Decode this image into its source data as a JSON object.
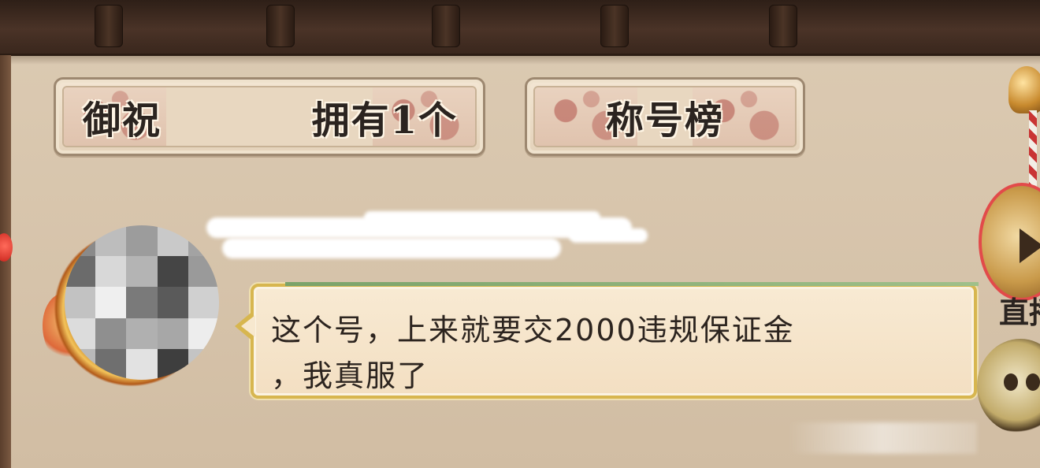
{
  "tabs": {
    "blessing": {
      "title": "御祝",
      "count": "拥有1个"
    },
    "title_rank": {
      "label": "称号榜"
    }
  },
  "chat": {
    "message": "这个号，上来就要交2000违规保证金\n，我真服了"
  },
  "side": {
    "live_label": "直播"
  },
  "icons": {
    "play": "play-icon",
    "bell": "bell-icon"
  },
  "colors": {
    "beam": "#3a271d",
    "wall": "#d8c6ae",
    "bubble_border": "#d7b64f",
    "tab_pattern": "#b05048"
  }
}
